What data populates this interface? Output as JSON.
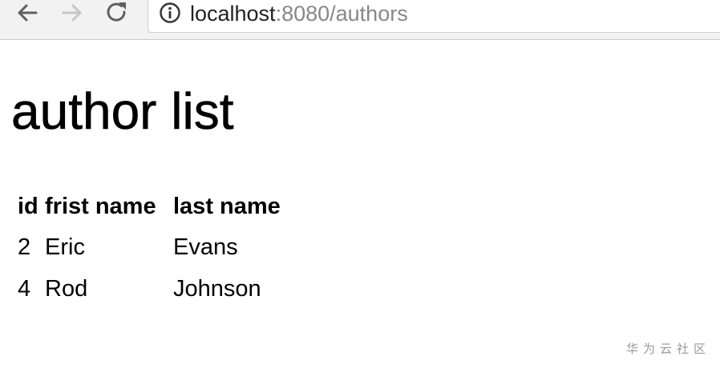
{
  "browser": {
    "url_host": "localhost",
    "url_rest": ":8080/authors",
    "icons": {
      "back": "back-arrow-icon",
      "forward": "forward-arrow-icon",
      "reload": "reload-icon",
      "info": "info-icon"
    },
    "forward_enabled": false
  },
  "page": {
    "title": "author list",
    "table": {
      "headers": [
        "id",
        "frist name",
        "last name"
      ],
      "rows": [
        [
          "2",
          "Eric",
          "Evans"
        ],
        [
          "4",
          "Rod",
          "Johnson"
        ]
      ]
    }
  },
  "watermark": "华为云社区"
}
